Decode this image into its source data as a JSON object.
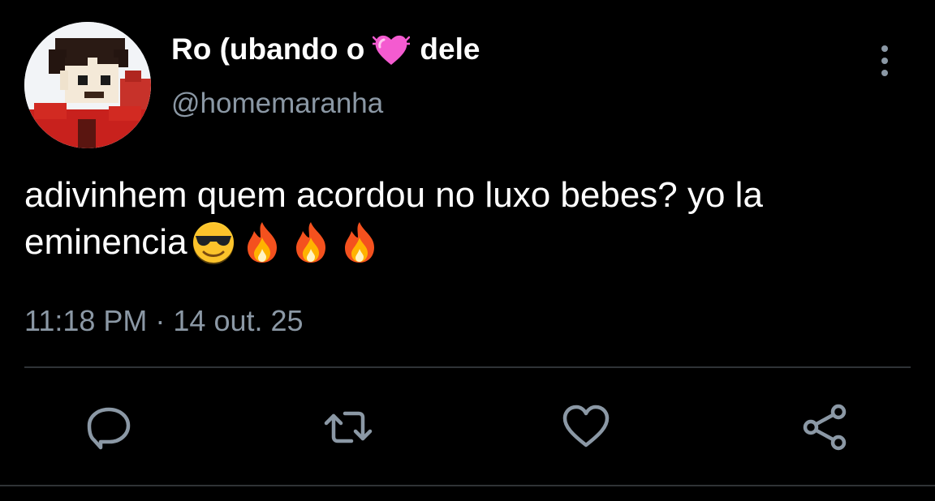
{
  "user": {
    "display_name_part1": "Ro (ubando o",
    "display_name_part2": "dele",
    "handle": "@homemaranha",
    "name_emoji": "growing-heart"
  },
  "tweet": {
    "text_line1": "adivinhem quem acordou no luxo bebes? yo la",
    "text_line2": "eminencia",
    "emojis": [
      "sunglasses-face",
      "fire",
      "fire",
      "fire"
    ],
    "timestamp": "11:18 PM · 14 out. 25"
  },
  "actions": {
    "reply_icon": "comment-icon",
    "retweet_icon": "retweet-icon",
    "like_icon": "heart-icon",
    "share_icon": "share-icon"
  },
  "colors": {
    "background": "#000000",
    "text_primary": "#ffffff",
    "text_secondary": "#8b98a5",
    "divider": "#2f3336"
  }
}
